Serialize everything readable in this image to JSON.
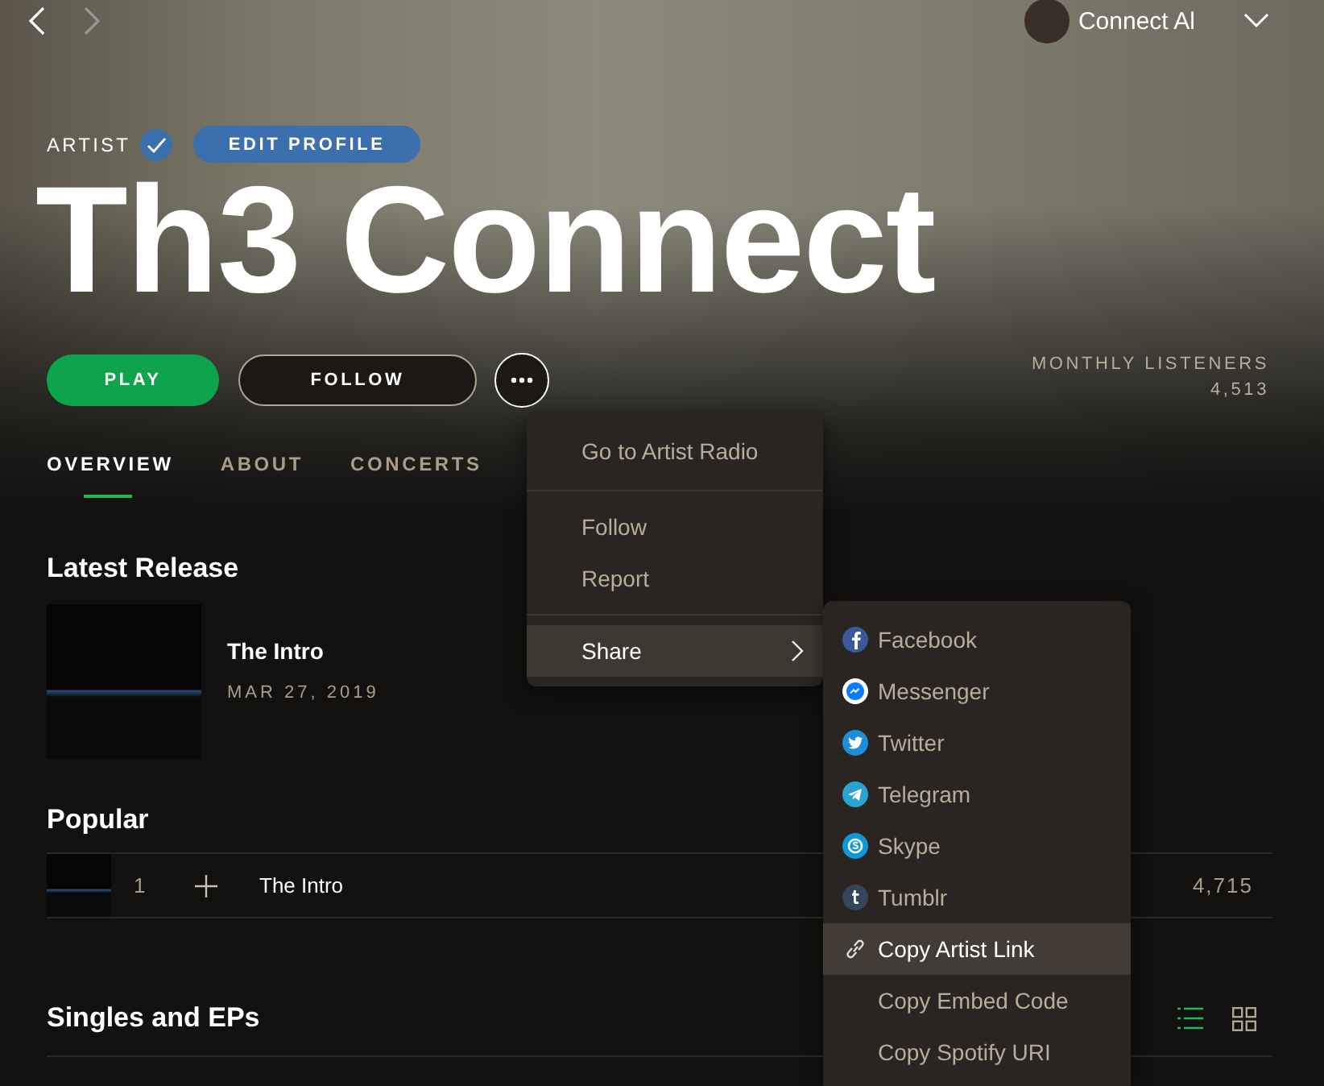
{
  "user": {
    "name": "Connect Al"
  },
  "artist": {
    "label": "ARTIST",
    "verified": true,
    "edit_button": "EDIT PROFILE",
    "name": "Th3 Connect"
  },
  "actions": {
    "play": "PLAY",
    "follow": "FOLLOW"
  },
  "monthly_listeners": {
    "label": "MONTHLY LISTENERS",
    "value": "4,513"
  },
  "tabs": [
    {
      "label": "OVERVIEW",
      "selected": true
    },
    {
      "label": "ABOUT",
      "selected": false
    },
    {
      "label": "CONCERTS",
      "selected": false
    }
  ],
  "latest_release": {
    "heading": "Latest Release",
    "title": "The Intro",
    "date": "MAR 27, 2019"
  },
  "popular": {
    "heading": "Popular",
    "tracks": [
      {
        "number": "1",
        "title": "The Intro",
        "plays": "4,715"
      }
    ]
  },
  "singles": {
    "heading": "Singles and EPs",
    "views": [
      {
        "kind": "list",
        "selected": true
      },
      {
        "kind": "grid",
        "selected": false
      }
    ]
  },
  "context_menu": {
    "groups": [
      [
        {
          "label": "Go to Artist Radio",
          "submenu": false,
          "selected": false
        }
      ],
      [
        {
          "label": "Follow",
          "submenu": false,
          "selected": false
        },
        {
          "label": "Report",
          "submenu": false,
          "selected": false
        }
      ],
      [
        {
          "label": "Share",
          "submenu": true,
          "selected": true
        }
      ]
    ]
  },
  "share_menu": {
    "items": [
      {
        "kind": "facebook",
        "label": "Facebook",
        "selected": false
      },
      {
        "kind": "messenger",
        "label": "Messenger",
        "selected": false
      },
      {
        "kind": "twitter",
        "label": "Twitter",
        "selected": false
      },
      {
        "kind": "telegram",
        "label": "Telegram",
        "selected": false
      },
      {
        "kind": "skype",
        "label": "Skype",
        "selected": false
      },
      {
        "kind": "tumblr",
        "label": "Tumblr",
        "selected": false
      },
      {
        "kind": "link",
        "label": "Copy Artist Link",
        "selected": true
      },
      {
        "kind": "none",
        "label": "Copy Embed Code",
        "selected": false
      },
      {
        "kind": "none",
        "label": "Copy Spotify URI",
        "selected": false
      }
    ]
  }
}
